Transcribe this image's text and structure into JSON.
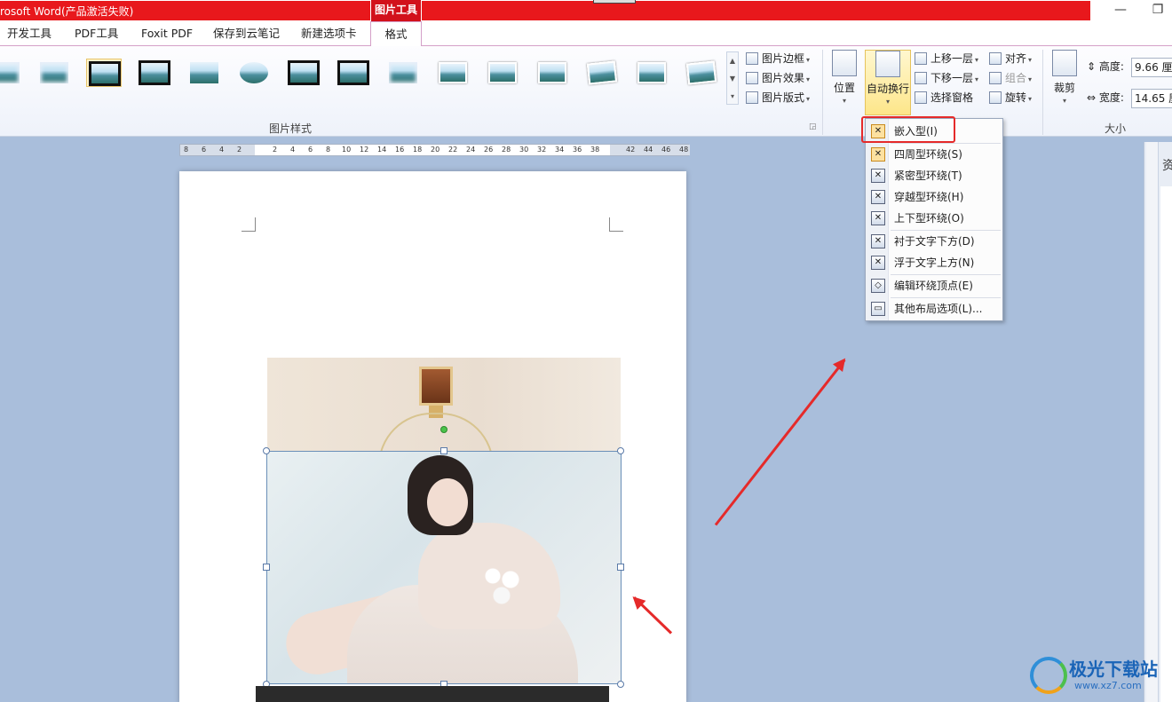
{
  "window": {
    "title": "rosoft Word(产品激活失败)",
    "context_tool": "图片工具",
    "minimize_glyph": "—",
    "restore_glyph": "❐"
  },
  "tabs": [
    "开发工具",
    "PDF工具",
    "Foxit PDF",
    "保存到云笔记",
    "新建选项卡",
    "格式"
  ],
  "ribbon": {
    "picture_styles_label": "图片样式",
    "picture_border": "图片边框",
    "picture_effect": "图片效果",
    "picture_layout": "图片版式",
    "position": "位置",
    "auto_wrap": "自动换行",
    "bring_forward": "上移一层",
    "send_backward": "下移一层",
    "selection_pane": "选择窗格",
    "align": "对齐",
    "group": "组合",
    "rotate": "旋转",
    "crop": "裁剪",
    "height_label": "高度:",
    "height_value": "9.66 厘米",
    "width_label": "宽度:",
    "width_value": "14.65 厘",
    "size_label": "大小"
  },
  "ruler": {
    "numbers": [
      "8",
      "6",
      "4",
      "2",
      "2",
      "4",
      "6",
      "8",
      "10",
      "12",
      "14",
      "16",
      "18",
      "20",
      "22",
      "24",
      "26",
      "28",
      "30",
      "32",
      "34",
      "36",
      "38",
      "42",
      "44",
      "46",
      "48"
    ]
  },
  "wrap_menu": {
    "items": [
      {
        "label": "嵌入型(I)",
        "icon": "inline-wrap-icon"
      },
      {
        "label": "四周型环绕(S)",
        "icon": "square-wrap-icon"
      },
      {
        "label": "紧密型环绕(T)",
        "icon": "tight-wrap-icon"
      },
      {
        "label": "穿越型环绕(H)",
        "icon": "through-wrap-icon"
      },
      {
        "label": "上下型环绕(O)",
        "icon": "top-bottom-wrap-icon"
      },
      {
        "label": "衬于文字下方(D)",
        "icon": "behind-text-icon"
      },
      {
        "label": "浮于文字上方(N)",
        "icon": "in-front-text-icon"
      },
      {
        "label": "编辑环绕顶点(E)",
        "icon": "edit-wrap-points-icon"
      },
      {
        "label": "其他布局选项(L)...",
        "icon": "more-layout-icon"
      }
    ]
  },
  "side_pane": {
    "label": "资"
  },
  "watermark": {
    "name": "极光下载站",
    "url": "www.xz7.com"
  },
  "colors": {
    "title_red": "#e8181c",
    "annotation_red": "#e52a2a",
    "menu_highlight": "#fde1a0"
  }
}
